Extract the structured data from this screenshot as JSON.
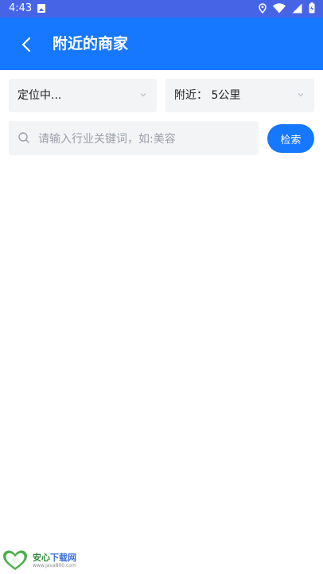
{
  "status_bar": {
    "time": "4:43",
    "icons": [
      "notification-icon",
      "location-icon",
      "wifi-icon",
      "signal-icon",
      "battery-icon"
    ]
  },
  "header": {
    "title": "附近的商家",
    "back_icon": "back-arrow-icon"
  },
  "filters": {
    "location_value": "定位中...",
    "distance_value": "附近： 5公里"
  },
  "search": {
    "placeholder": "请输入行业关键词，如:美容",
    "value": "",
    "button_label": "检索"
  },
  "watermark": {
    "title_green": "安心",
    "title_blue": "下载网",
    "url": "www.java800.com"
  },
  "colors": {
    "status_bar": "#4665e6",
    "header": "#1677ff",
    "field_bg": "#f3f4f6",
    "button": "#1677ff"
  }
}
